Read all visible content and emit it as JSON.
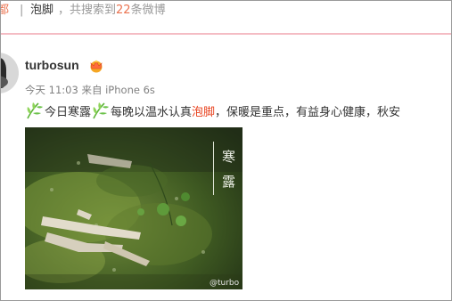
{
  "search": {
    "prev_fragment": "都",
    "separator": "|",
    "keyword": "泡脚",
    "result_prefix": "，共搜索到",
    "count": "22",
    "result_suffix": "条微博"
  },
  "colors": {
    "accent": "#eb7350",
    "highlight": "#e8401c",
    "divider_pink": "#f4bcc4",
    "leaf_green": "#6cc24a"
  },
  "post": {
    "username": "turbosun",
    "badge_icon": "crown-icon",
    "time": "今天 11:03",
    "source_prefix": "来自",
    "source": "iPhone 6s",
    "text_part1": "今日寒露",
    "text_part2": "每晚以温水认真",
    "text_highlight": "泡脚",
    "text_part3": "，保暖是重点，有益身心健康，秋安",
    "leaf_icon": "green-leaf-emoji",
    "image": {
      "title_line1": "寒",
      "title_line2": "露",
      "watermark": "@turbo"
    }
  }
}
